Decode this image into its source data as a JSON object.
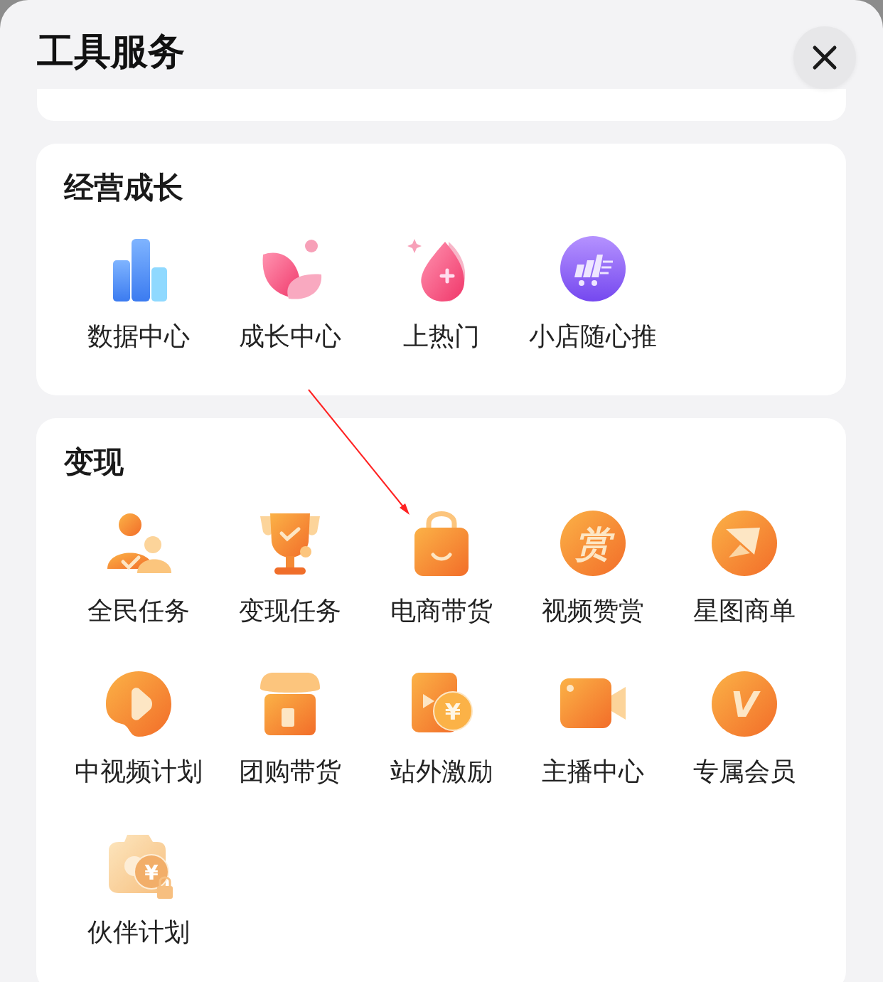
{
  "header": {
    "title": "工具服务"
  },
  "sections": [
    {
      "title": "经营成长",
      "tools": [
        {
          "label": "数据中心",
          "kind": "bars",
          "locked": false
        },
        {
          "label": "成长中心",
          "kind": "petals",
          "locked": false
        },
        {
          "label": "上热门",
          "kind": "drop",
          "locked": false
        },
        {
          "label": "小店随心推",
          "kind": "cart",
          "locked": false
        }
      ]
    },
    {
      "title": "变现",
      "tools": [
        {
          "label": "全民任务",
          "kind": "people",
          "locked": false
        },
        {
          "label": "变现任务",
          "kind": "trophy",
          "locked": false
        },
        {
          "label": "电商带货",
          "kind": "bag",
          "locked": false
        },
        {
          "label": "视频赞赏",
          "kind": "glyph_circle",
          "glyph": "赏",
          "locked": false
        },
        {
          "label": "星图商单",
          "kind": "plane",
          "locked": false
        },
        {
          "label": "中视频计划",
          "kind": "play",
          "locked": false
        },
        {
          "label": "团购带货",
          "kind": "shop",
          "locked": false
        },
        {
          "label": "站外激励",
          "kind": "video_coin",
          "glyph": "¥",
          "locked": false
        },
        {
          "label": "主播中心",
          "kind": "camera",
          "locked": false
        },
        {
          "label": "专属会员",
          "kind": "glyph_circle",
          "glyph": "V",
          "locked": false
        },
        {
          "label": "伙伴计划",
          "kind": "wallet_coin",
          "glyph": "¥",
          "locked": true
        }
      ]
    }
  ],
  "annotation": {
    "kind": "arrow"
  }
}
